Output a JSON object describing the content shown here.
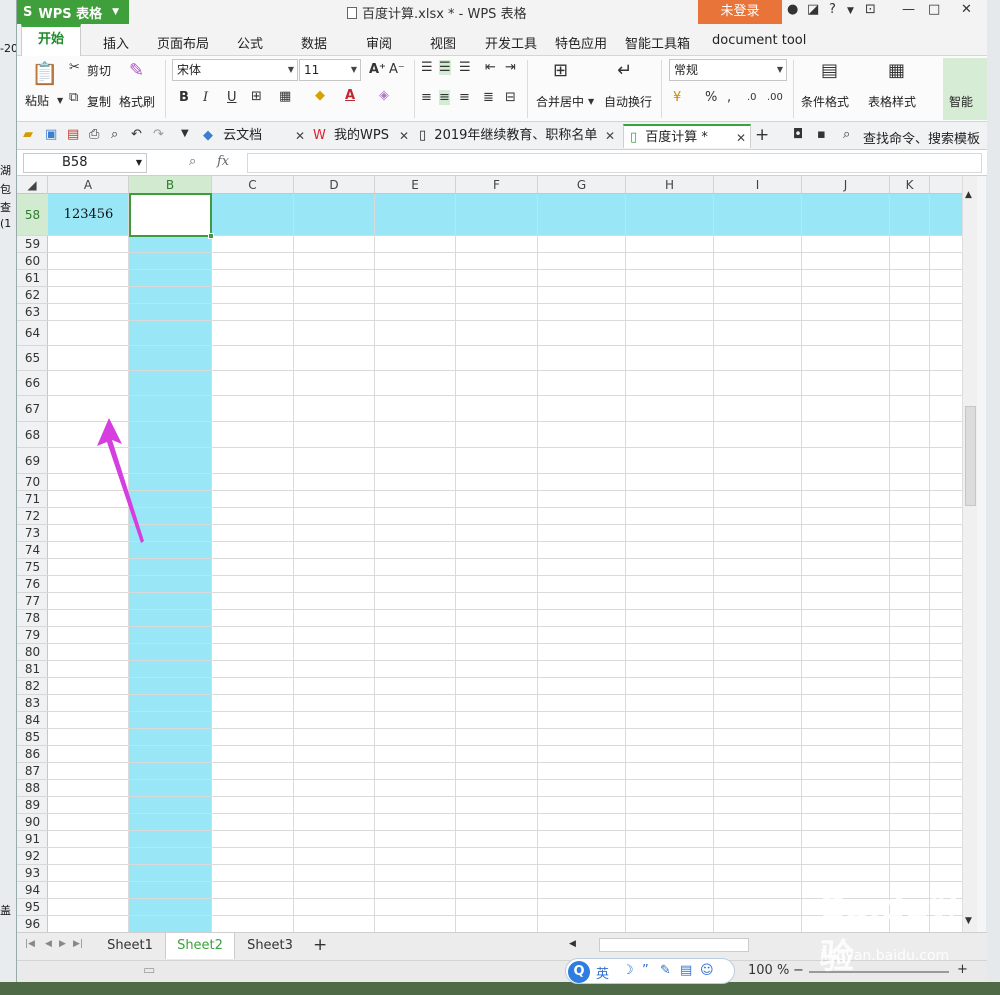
{
  "desktop": {
    "left_texts": [
      "-20",
      "湖",
      "包",
      "查",
      "(1",
      "盖"
    ]
  },
  "titlebar": {
    "app_name": "WPS 表格",
    "doc_title": "百度计算.xlsx * - WPS 表格",
    "login": "未登录"
  },
  "ribbon_tabs": [
    "开始",
    "插入",
    "页面布局",
    "公式",
    "数据",
    "审阅",
    "视图",
    "开发工具",
    "特色应用",
    "智能工具箱",
    "document tool"
  ],
  "ribbon": {
    "paste": "粘贴",
    "cut": "剪切",
    "copy": "复制",
    "format_painter": "格式刷",
    "font_name": "宋体",
    "font_size": "11",
    "merge_center": "合并居中",
    "wrap_text": "自动换行",
    "number_format": "常规",
    "percent": "%",
    "conditional_format": "条件格式",
    "table_style": "表格样式",
    "smart": "智能"
  },
  "doc_tabs": [
    "云文档",
    "我的WPS",
    "2019年继续教育、职称名单",
    "百度计算 *"
  ],
  "search_cmd": "查找命令、搜索模板",
  "formula_bar": {
    "name_box": "B58",
    "fx": "fx",
    "content": ""
  },
  "columns": [
    "A",
    "B",
    "C",
    "D",
    "E",
    "F",
    "G",
    "H",
    "I",
    "J",
    "K"
  ],
  "rows": [
    "58",
    "59",
    "60",
    "61",
    "62",
    "63",
    "64",
    "65",
    "66",
    "67",
    "68",
    "69",
    "70",
    "71",
    "72",
    "73",
    "74",
    "75",
    "76",
    "77",
    "78",
    "79",
    "80",
    "81",
    "82",
    "83",
    "84",
    "85",
    "86",
    "87",
    "88",
    "89",
    "90",
    "91",
    "92",
    "93",
    "94",
    "95",
    "96"
  ],
  "cells": {
    "A58": "123456",
    "B58": ""
  },
  "sheets": [
    "Sheet1",
    "Sheet2",
    "Sheet3"
  ],
  "active_sheet": "Sheet2",
  "status": {
    "ime_label": "英",
    "zoom": "100 %"
  },
  "watermark": {
    "brand": "Baidu经验",
    "url": "jingyan.baidu.com"
  },
  "colors": {
    "highlight": "#99e6f6",
    "accent_green": "#3aa33b",
    "login_orange": "#e9743a",
    "annotation_arrow": "#d63ee0"
  }
}
